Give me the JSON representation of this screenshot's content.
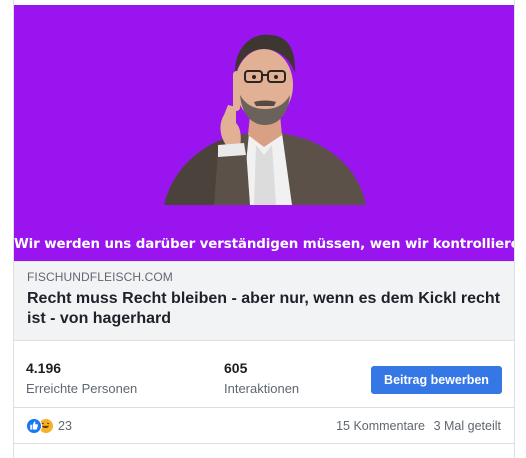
{
  "post": {
    "image": {
      "caption": "Wir werden uns darüber verständigen müssen, wen wir kontrollieren.",
      "background_color": "#9a14f0"
    },
    "link": {
      "domain": "FISCHUNDFLEISCH.COM",
      "title": "Recht muss Recht bleiben - aber nur, wenn es dem Kickl recht ist - von hagerhard"
    }
  },
  "insights": {
    "reach": {
      "value": "4.196",
      "label": "Erreichte Personen"
    },
    "interactions": {
      "value": "605",
      "label": "Interaktionen"
    },
    "boost_label": "Beitrag bewerben",
    "boost_color": "#3578e5"
  },
  "footer": {
    "reactions": {
      "icons": [
        "like-icon",
        "haha-icon"
      ],
      "count": "23"
    },
    "comments_text": "15 Kommentare",
    "shares_text": "3 Mal geteilt"
  }
}
